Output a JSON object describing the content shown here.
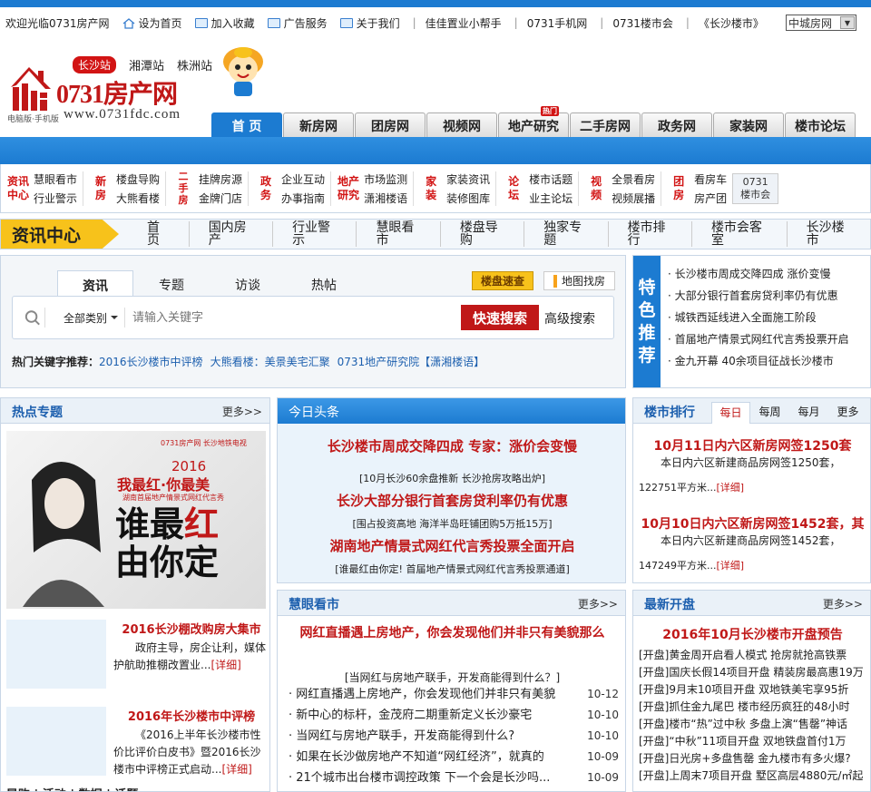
{
  "topbar": {
    "welcome": "欢迎光临0731房产网",
    "links": [
      "设为首页",
      "加入收藏",
      "广告服务",
      "关于我们"
    ],
    "helper": "佳佳置业小帮手",
    "mobile": "0731手机网",
    "loushihui": "0731楼市会",
    "changsha": "《长沙楼市》",
    "city_select": "中城房网"
  },
  "header": {
    "station_active": "长沙站",
    "stations": [
      "湘潭站",
      "株洲站"
    ],
    "logo_name": "0731房产网",
    "logo_sub": "电脑版·手机版",
    "logo_url": "www.0731fdc.com"
  },
  "mainnav": {
    "tabs": [
      "首 页",
      "新房网",
      "团房网",
      "视频网",
      "地产研究",
      "二手房网",
      "政务网",
      "家装网",
      "楼市论坛"
    ],
    "hot_tag": "热门"
  },
  "subnav": {
    "groups": [
      {
        "title": "资讯\n中心",
        "col1": [
          "慧眼看市",
          "行业警示"
        ],
        "col2": []
      },
      {
        "title": "新\n房",
        "col1": [
          "楼盘导购",
          "大熊看楼"
        ],
        "col2": []
      },
      {
        "title": "二\n手\n房",
        "col1": [
          "挂牌房源",
          "金牌门店"
        ],
        "col2": []
      },
      {
        "title": "政\n务",
        "col1": [
          "企业互动",
          "办事指南"
        ],
        "col2": []
      },
      {
        "title": "地产\n研究",
        "col1": [
          "市场监测",
          "潇湘楼语"
        ],
        "col2": []
      },
      {
        "title": "家\n装",
        "col1": [
          "家装资讯",
          "装修图库"
        ],
        "col2": []
      },
      {
        "title": "论\n坛",
        "col1": [
          "楼市话题",
          "业主论坛"
        ],
        "col2": []
      },
      {
        "title": "视\n频",
        "col1": [
          "全景看房",
          "视频展播"
        ],
        "col2": []
      },
      {
        "title": "团\n房",
        "col1": [
          "看房车",
          "房产团"
        ],
        "col2": []
      }
    ],
    "loushihui_btn": "0731\n楼市会"
  },
  "secnav": {
    "badge": "资讯中心",
    "items": [
      "首页",
      "国内房产",
      "行业警示",
      "慧眼看市",
      "楼盘导购",
      "独家专题",
      "楼市排行",
      "楼市会客室",
      "长沙楼市"
    ]
  },
  "search": {
    "tabs": [
      "资讯",
      "专题",
      "访谈",
      "热帖"
    ],
    "quick_btn": "楼盘速查",
    "map_btn": "地图找房",
    "category": "全部类别",
    "placeholder": "请输入关键字",
    "go_btn": "快速搜索",
    "advanced": "高级搜索",
    "hot_label": "热门关键字推荐：",
    "hot_keywords": [
      "2016长沙楼市中评榜",
      "大熊看楼：美景美宅汇聚",
      "0731地产研究院【潇湘楼语】"
    ]
  },
  "featured": {
    "tag": "特\n色\n推\n荐",
    "items": [
      "长沙楼市周成交降四成 涨价变慢",
      "大部分银行首套房贷利率仍有优惠",
      "城铁西延线进入全面施工阶段",
      "首届地产情景式网红代言秀投票开启",
      "金九开幕  40余项目征战长沙楼市"
    ]
  },
  "hot_topics": {
    "title": "热点专题",
    "more": "更多>>",
    "banner": {
      "logo": "0731房产网  长沙地铁电视",
      "year": "2016",
      "line1": "我最红·你最美",
      "line2": "湖南首届地产情景式网红代言秀",
      "line3a": "谁最",
      "line3b": "红",
      "line3c": "由你定"
    },
    "items": [
      {
        "title": "2016长沙棚改购房大集市",
        "desc": "政府主导，房企让利，媒体护航助推棚改置业...",
        "detail": "[详细]"
      },
      {
        "title": "2016年长沙楼市中评榜",
        "desc": "《2016上半年长沙楼市性价比评价白皮书》暨2016长沙楼市中评榜正式启动...",
        "detail": "[详细]"
      }
    ],
    "bottom_tabs": "导购 | 活动 | 数据 | 话题"
  },
  "headlines": {
    "title": "今日头条",
    "items": [
      {
        "headline": "长沙楼市周成交降四成  专家：涨价会变慢",
        "sub": ""
      },
      {
        "headline": "",
        "sub": "[10月长沙60余盘推新  长沙抢房攻略出炉]"
      },
      {
        "headline": "长沙大部分银行首套房贷利率仍有优惠",
        "sub": "[围占投资高地  海洋半岛旺铺团购5万抵15万]"
      },
      {
        "headline": "湖南地产情景式网红代言秀投票全面开启",
        "sub": "[谁最红由你定! 首届地产情景式网红代言秀投票通道]"
      }
    ]
  },
  "market_view": {
    "title": "慧眼看市",
    "more": "更多>>",
    "headline": "网红直播遇上房地产，你会发现他们并非只有美貌那么",
    "sub": "[当网红与房地产联手，开发商能得到什么？]",
    "list": [
      {
        "text": "网红直播遇上房地产，你会发现他们并非只有美貌",
        "date": "10-12"
      },
      {
        "text": "新中心的标杆，金茂府二期重新定义长沙豪宅",
        "date": "10-10"
      },
      {
        "text": "当网红与房地产联手，开发商能得到什么?",
        "date": "10-10"
      },
      {
        "text": "如果在长沙做房地产不知道“网红经济”，就真的",
        "date": "10-09"
      },
      {
        "text": "21个城市出台楼市调控政策  下一个会是长沙吗...",
        "date": "10-09"
      }
    ]
  },
  "ranking": {
    "title": "楼市排行",
    "tabs": [
      "每日",
      "每周",
      "每月",
      "更多"
    ],
    "items": [
      {
        "title": "10月11日内六区新房网签1250套",
        "desc": "本日内六区新建商品房网签1250套，",
        "area": "122751平方米...",
        "detail": "[详细]"
      },
      {
        "title": "10月10日内六区新房网签1452套，其",
        "desc": "本日内六区新建商品房网签1452套，",
        "area": "147249平方米...",
        "detail": "[详细]"
      }
    ]
  },
  "new_openings": {
    "title": "最新开盘",
    "more": "更多>>",
    "subtitle": "2016年10月长沙楼市开盘预告",
    "list": [
      "[开盘]黄金周开启看人模式  抢房就抢高铁票",
      "[开盘]国庆长假14项目开盘  精装房最高惠19万",
      "[开盘]9月末10项目开盘  双地铁美宅享95折",
      "[开盘]抓住金九尾巴  楼市经历疯狂的48小时",
      "[开盘]楼市“热”过中秋  多盘上演“售罄”神话",
      "[开盘]“中秋”11项目开盘  双地铁盘首付1万",
      "[开盘]日光房+多盘售罄  金九楼市有多火爆?",
      "[开盘]上周末7项目开盘  墅区高层4880元/㎡起"
    ]
  }
}
